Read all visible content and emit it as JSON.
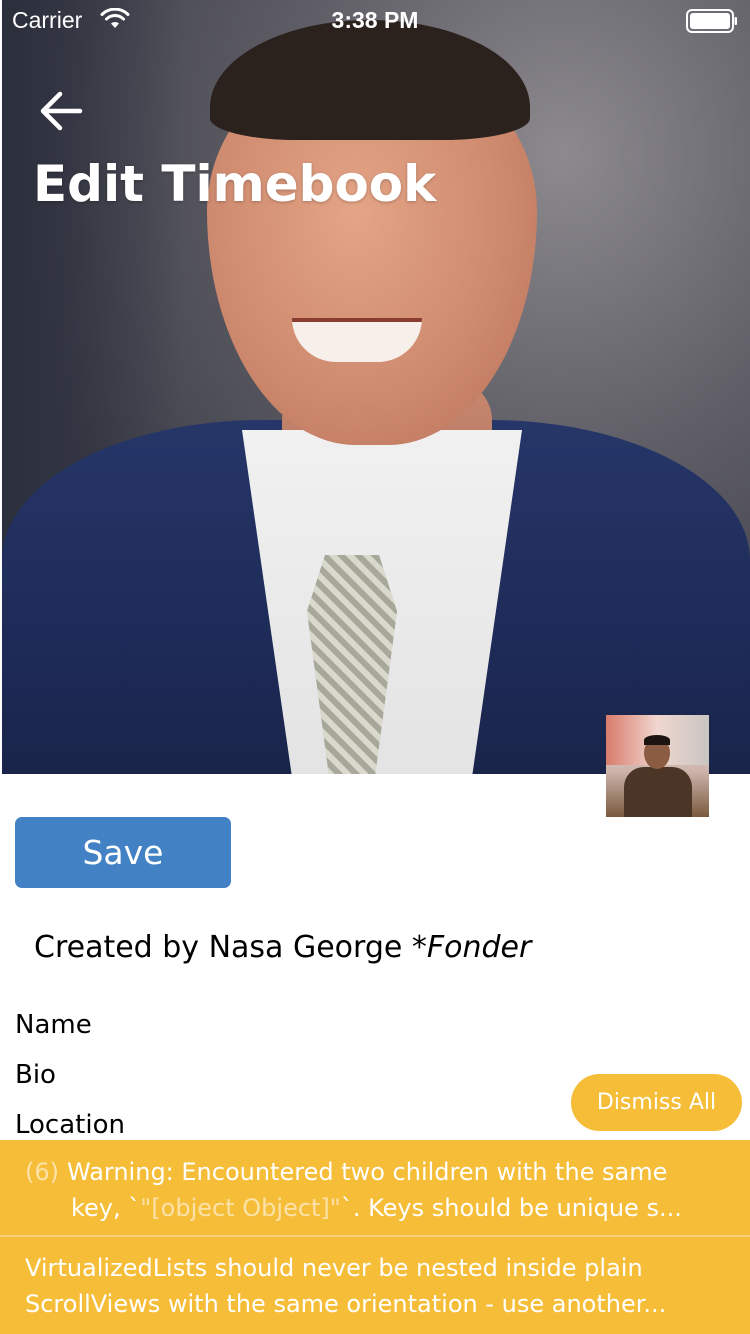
{
  "status_bar": {
    "carrier": "Carrier",
    "time": "3:38 PM"
  },
  "header": {
    "title": "Edit Timebook",
    "back_icon": "arrow-left-icon"
  },
  "actions": {
    "save_label": "Save",
    "dismiss_all_label": "Dismiss All"
  },
  "creator": {
    "prefix": "Created by Nasa George ",
    "role": "*Fonder"
  },
  "fields": {
    "name_label": "Name",
    "bio_label": "Bio",
    "location_label": "Location"
  },
  "warnings": [
    {
      "count": "(6)",
      "line1": "Warning: Encountered two children with the same",
      "line2_prefix": "key, `",
      "line2_muted": "\"[object Object]\"",
      "line2_suffix": "`. Keys should be unique s..."
    },
    {
      "line1": "VirtualizedLists should never be nested inside plain",
      "line2": "ScrollViews with the same orientation - use another..."
    }
  ],
  "colors": {
    "save_button": "#4281c3",
    "warning": "#f6bd38"
  }
}
